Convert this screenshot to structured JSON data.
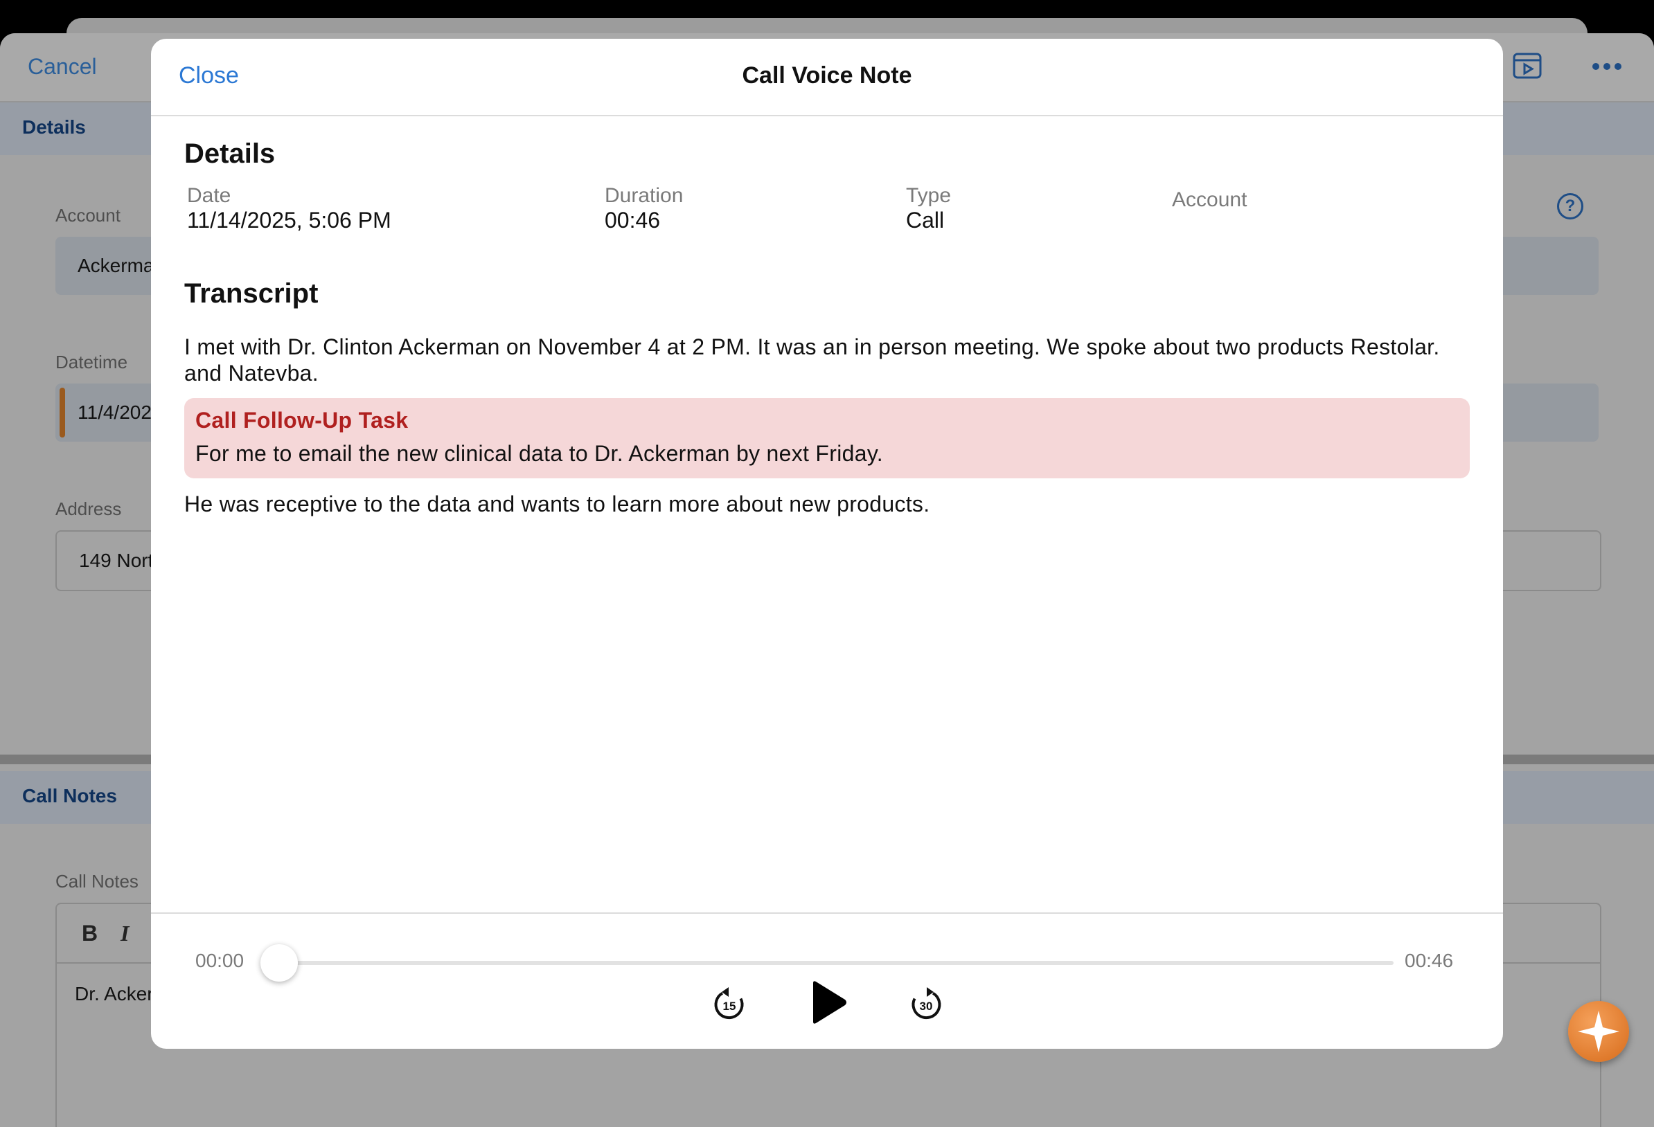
{
  "background": {
    "cancel_label": "Cancel",
    "details_section": "Details",
    "account_label": "Account",
    "account_value": "Ackerma",
    "datetime_label": "Datetime",
    "datetime_value": "11/4/202",
    "address_label": "Address",
    "address_value": "149 Nort",
    "call_notes_section": "Call Notes",
    "call_notes_label": "Call Notes",
    "bold_tool": "B",
    "italic_tool": "I",
    "editor_text": "Dr. Acker",
    "help_glyph": "?"
  },
  "modal": {
    "close_label": "Close",
    "title": "Call Voice Note",
    "details_heading": "Details",
    "date_label": "Date",
    "date_value": "11/14/2025, 5:06 PM",
    "duration_label": "Duration",
    "duration_value": "00:46",
    "type_label": "Type",
    "type_value": "Call",
    "account_label": "Account",
    "transcript_heading": "Transcript",
    "transcript_para1": "I met with Dr. Clinton Ackerman on November 4 at 2 PM. It was an in person meeting. We spoke about two products Restolar. and Natevba.",
    "task": {
      "title": "Call Follow-Up Task",
      "body": "For me to email the new clinical data to Dr. Ackerman by next Friday."
    },
    "transcript_para2": "He was receptive to the data and wants to learn more about new products."
  },
  "player": {
    "current_time": "00:00",
    "total_time": "00:46",
    "progress": 0,
    "rewind_seconds": "15",
    "forward_seconds": "30"
  },
  "colors": {
    "accent_link": "#2b78d4",
    "task_background": "#f5d7d8",
    "task_title": "#b0201f",
    "fab_orange": "#e07a28"
  }
}
